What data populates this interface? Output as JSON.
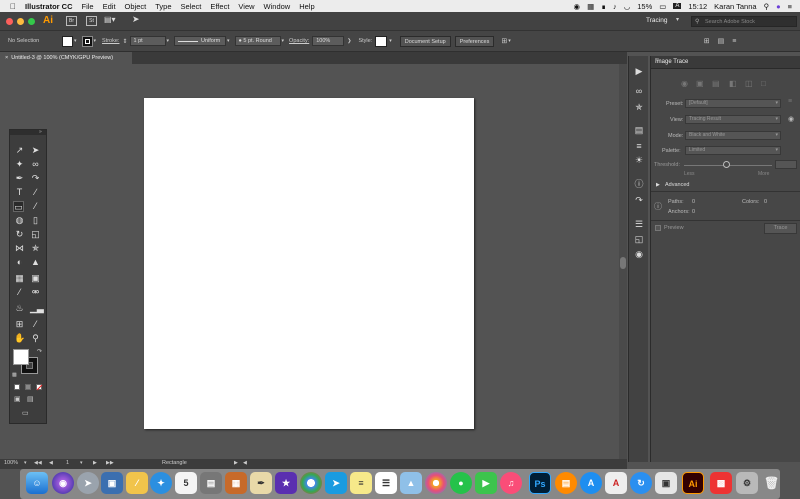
{
  "menubar": {
    "apple": "",
    "app_name": "Illustrator CC",
    "items": [
      "File",
      "Edit",
      "Object",
      "Type",
      "Select",
      "Effect",
      "View",
      "Window",
      "Help"
    ],
    "battery": "15%",
    "time": "15:12",
    "user": "Karan Tanna"
  },
  "appbar": {
    "logo": "Ai",
    "br": "Br",
    "st": "St",
    "workspace": "Tracing",
    "search_placeholder": "Search Adobe Stock"
  },
  "control_bar": {
    "selection": "No Selection",
    "stroke_label": "Stroke:",
    "stroke_value": "1 pt",
    "uniform": "Uniform",
    "brush": "5 pt. Round",
    "opacity_label": "Opacity:",
    "opacity_value": "100%",
    "style_label": "Style:",
    "document_setup": "Document Setup",
    "preferences": "Preferences"
  },
  "document": {
    "tab_label": "Untitled-3 @ 100% (CMYK/GPU Preview)",
    "close": "×"
  },
  "status": {
    "zoom": "100%",
    "artboard": "1",
    "tool": "Rectangle"
  },
  "image_trace": {
    "title": "Image Trace",
    "preset_label": "Preset:",
    "preset_value": "[Default]",
    "view_label": "View:",
    "view_value": "Tracing Result",
    "mode_label": "Mode:",
    "mode_value": "Black and White",
    "palette_label": "Palette:",
    "palette_value": "Limited",
    "threshold_label": "Threshold:",
    "threshold_less": "Less",
    "threshold_more": "More",
    "advanced": "Advanced",
    "paths_label": "Paths:",
    "paths_value": "0",
    "colors_label": "Colors:",
    "colors_value": "0",
    "anchors_label": "Anchors:",
    "anchors_value": "0",
    "preview": "Preview",
    "trace_button": "Trace"
  },
  "dock": {
    "calendar_day": "5",
    "ps": "Ps",
    "ai": "Ai"
  },
  "colors": {
    "ui_bg": "#535353",
    "menubar": "#ececec",
    "artboard": "#ffffff",
    "ai_orange": "#ff9a00",
    "ps_blue": "#31a8ff"
  }
}
